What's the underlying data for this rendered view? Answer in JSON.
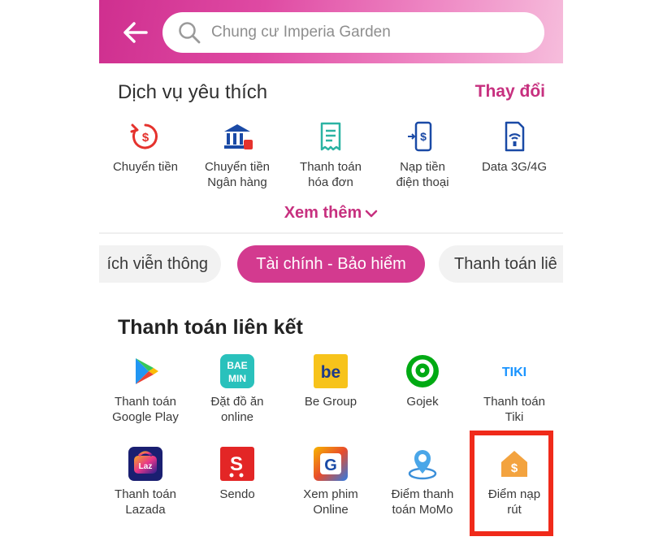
{
  "search": {
    "placeholder": "Chung cư Imperia Garden"
  },
  "favorites": {
    "title": "Dịch vụ yêu thích",
    "change_label": "Thay đổi",
    "items": [
      {
        "label": "Chuyển tiền",
        "icon": "money-transfer-icon"
      },
      {
        "label": "Chuyển tiền\nNgân hàng",
        "icon": "bank-icon"
      },
      {
        "label": "Thanh toán\nhóa đơn",
        "icon": "bill-icon"
      },
      {
        "label": "Nạp tiền\nđiện thoại",
        "icon": "phone-topup-icon"
      },
      {
        "label": "Data 3G/4G",
        "icon": "sim-data-icon"
      }
    ],
    "more_label": "Xem thêm"
  },
  "tabs": [
    {
      "label": "ích viễn thông",
      "active": false
    },
    {
      "label": "Tài chính - Bảo hiểm",
      "active": true
    },
    {
      "label": "Thanh toán liê",
      "active": false
    }
  ],
  "linked": {
    "title": "Thanh toán liên kết",
    "items": [
      {
        "label": "Thanh toán\nGoogle Play",
        "icon": "google-play-icon"
      },
      {
        "label": "Đặt đồ ăn\nonline",
        "icon": "baemin-icon",
        "icon_text": "BAE\nMIN"
      },
      {
        "label": "Be Group",
        "icon": "be-group-icon",
        "icon_text": "be"
      },
      {
        "label": "Gojek",
        "icon": "gojek-icon"
      },
      {
        "label": "Thanh toán\nTiki",
        "icon": "tiki-icon",
        "icon_text": "TIKI"
      },
      {
        "label": "Thanh toán\nLazada",
        "icon": "lazada-icon",
        "icon_text": "Laz"
      },
      {
        "label": "Sendo",
        "icon": "sendo-icon"
      },
      {
        "label": "Xem phim\nOnline",
        "icon": "galaxy-play-icon",
        "icon_text": "G"
      },
      {
        "label": "Điểm thanh\ntoán MoMo",
        "icon": "momo-location-icon"
      },
      {
        "label": "Điểm nạp\nrút",
        "icon": "cash-point-icon"
      }
    ]
  },
  "colors": {
    "brand": "#c7307f",
    "highlight": "#f02a1a"
  }
}
